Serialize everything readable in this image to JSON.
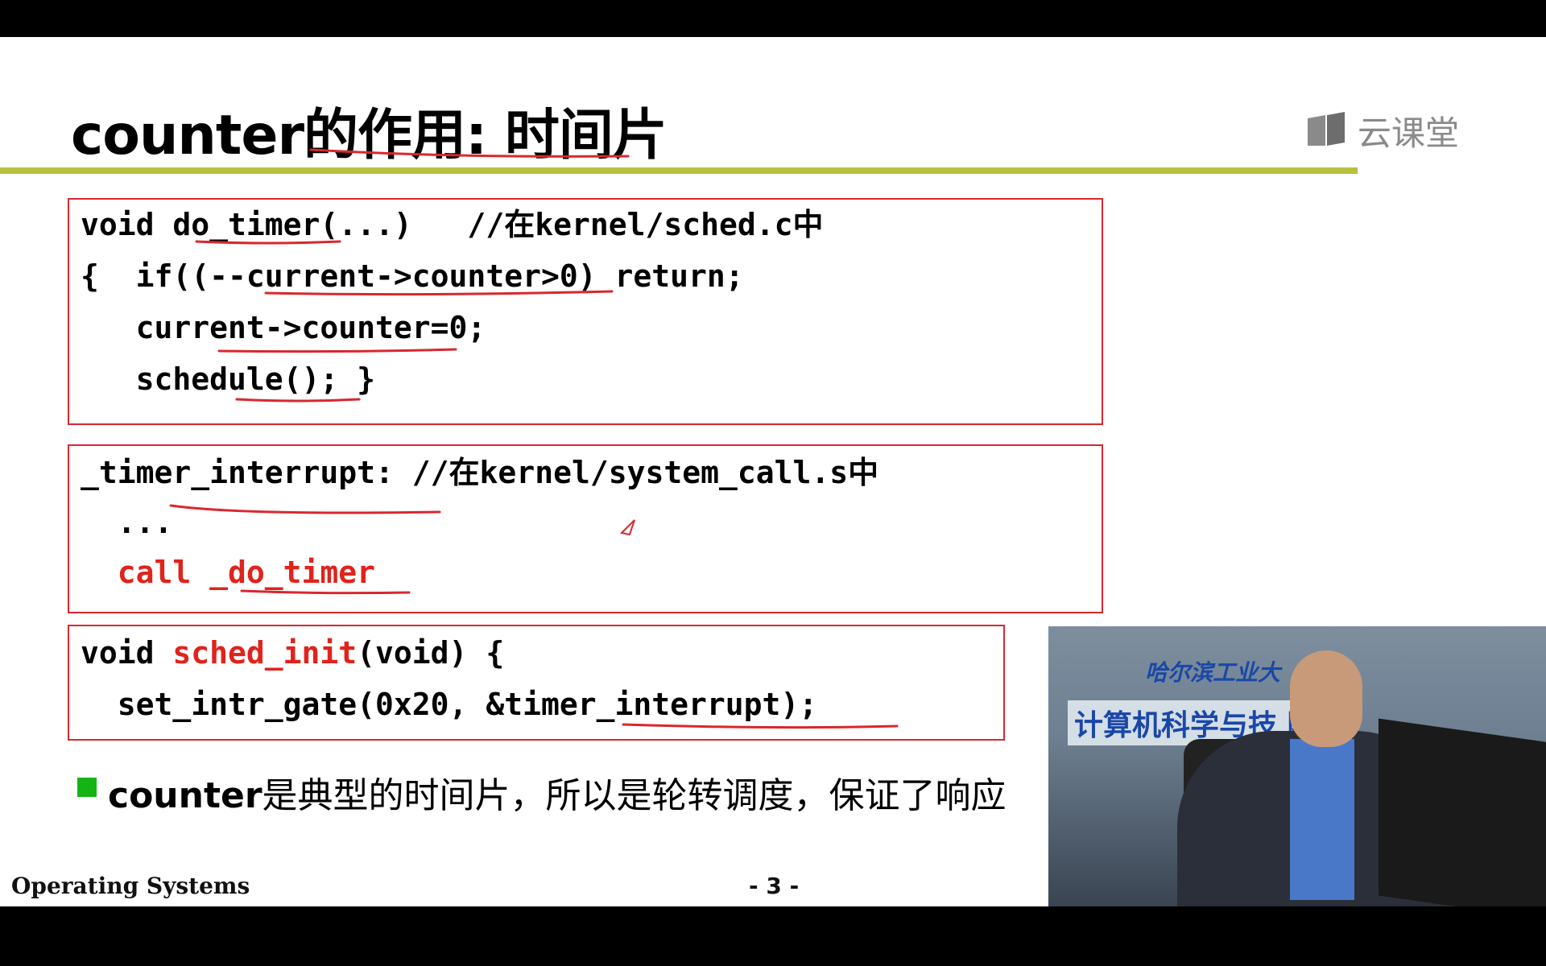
{
  "slide": {
    "title": "counter的作用: 时间片",
    "logo_text": "云课堂",
    "logo_icon": "book-icon",
    "box1": {
      "lines": [
        "void do_timer(...)   //在kernel/sched.c中",
        "{  if((--current->counter>0) return;",
        "   current->counter=0;",
        "   schedule(); }"
      ]
    },
    "box2": {
      "line1": "_timer_interrupt: //在kernel/system_call.s中",
      "line2": "  ...",
      "line3": "  call _do_timer"
    },
    "box3": {
      "line1_a": "void ",
      "line1_b": "sched_init",
      "line1_c": "(void) {",
      "line2": "  set_intr_gate(0x20, &timer_interrupt);"
    },
    "bullet": {
      "bold": "counter",
      "text": "是典型的时间片，所以是轮转调度，保证了响应"
    },
    "footer_left": "Operating Systems",
    "page_number": "- 3 -"
  },
  "video": {
    "university": "哈尔滨工业大",
    "banner": "计算机科学与技  院"
  },
  "colors": {
    "accent_rule": "#b7c13d",
    "box_border": "#d9272e",
    "highlight_code": "#e0231b",
    "bullet": "#14b414",
    "annotation": "#d9272e"
  }
}
